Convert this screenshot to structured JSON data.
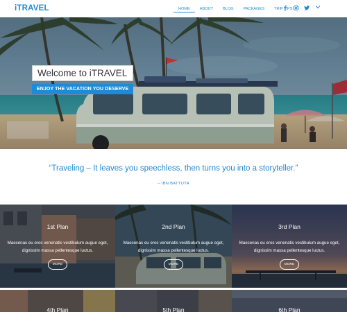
{
  "header": {
    "logo": "iTRAVEL",
    "nav": [
      {
        "label": "HOME",
        "active": true
      },
      {
        "label": "ABOUT",
        "active": false
      },
      {
        "label": "BLOG",
        "active": false
      },
      {
        "label": "PACKAGES",
        "active": false
      },
      {
        "label": "TRIP TIPS",
        "active": false
      }
    ],
    "social_icons": [
      "facebook-icon",
      "instagram-icon",
      "twitter-icon"
    ],
    "accent_color": "#1f8bd6"
  },
  "hero": {
    "welcome": "Welcome to iTRAVEL",
    "tagline": "ENJOY THE VACATION YOU DESERVE"
  },
  "quote": {
    "text": "“Traveling – It leaves you speechless, then turns you into a storyteller.”",
    "author": "– IBN BATTUTA"
  },
  "plans": [
    {
      "title": "1st Plan",
      "desc": "Maecenas eu eros venenatis vestibulum augue eget, dignissim massa pellentesque luctus.",
      "button": "MORE"
    },
    {
      "title": "2nd Plan",
      "desc": "Maecenas eu eros venenatis vestibulum augue eget, dignissim massa pellentesque luctus.",
      "button": "MORE"
    },
    {
      "title": "3rd Plan",
      "desc": "Maecenas eu eros venenatis vestibulum augue eget, dignissim massa pellentesque luctus.",
      "button": "MORE"
    },
    {
      "title": "4th Plan"
    },
    {
      "title": "5th Plan"
    },
    {
      "title": "6th Plan"
    }
  ]
}
